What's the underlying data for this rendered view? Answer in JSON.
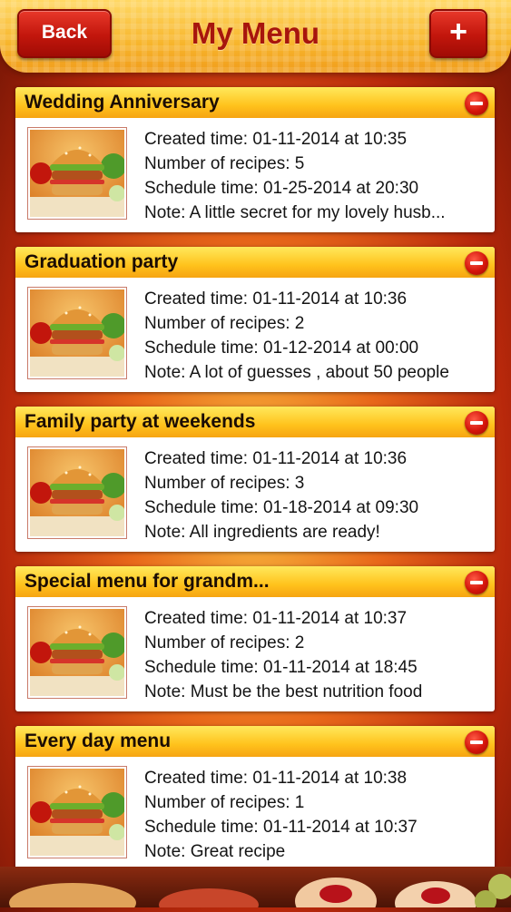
{
  "header": {
    "title": "My Menu",
    "back_label": "Back",
    "add_label": "+"
  },
  "colors": {
    "accent": "#c2160c",
    "title": "#a7150d",
    "card_header": "#ffc21c"
  },
  "menus": [
    {
      "title": "Wedding Anniversary",
      "created": "Created time: 01-11-2014 at 10:35",
      "recipes": "Number of recipes: 5",
      "schedule": "Schedule time: 01-25-2014 at 20:30",
      "note": "Note: A little secret for my lovely husb..."
    },
    {
      "title": "Graduation party",
      "created": "Created time: 01-11-2014 at 10:36",
      "recipes": "Number of recipes: 2",
      "schedule": "Schedule time: 01-12-2014 at 00:00",
      "note": "Note: A lot of guesses , about 50 people"
    },
    {
      "title": "Family party at weekends",
      "created": "Created time: 01-11-2014 at 10:36",
      "recipes": "Number of recipes: 3",
      "schedule": "Schedule time: 01-18-2014 at 09:30",
      "note": "Note: All ingredients are ready!"
    },
    {
      "title": "Special menu for grandm...",
      "created": "Created time: 01-11-2014 at 10:37",
      "recipes": "Number of recipes: 2",
      "schedule": "Schedule time: 01-11-2014 at 18:45",
      "note": "Note: Must be the best nutrition food"
    },
    {
      "title": "Every day menu",
      "created": "Created time: 01-11-2014 at 10:38",
      "recipes": "Number of recipes: 1",
      "schedule": "Schedule time: 01-11-2014 at 10:37",
      "note": "Note: Great recipe"
    }
  ],
  "icons": {
    "delete": "minus-circle-icon",
    "thumbnail": "burger-icon"
  }
}
